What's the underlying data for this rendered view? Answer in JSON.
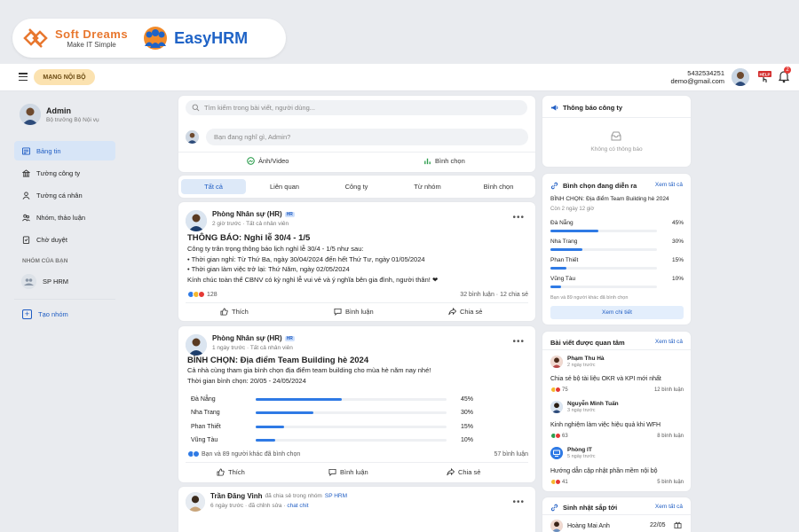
{
  "brand": {
    "softdreams_name": "Soft Dreams",
    "softdreams_tagline": "Make IT Simple",
    "product": "EasyHRM"
  },
  "topbar": {
    "internal_button": "MẠNG NỘI BỘ",
    "user_phone": "5432534251",
    "user_email": "demo@gmail.com",
    "help_label": "HELP",
    "notif_count": "2"
  },
  "sidebar": {
    "user_name": "Admin",
    "user_role": "Bộ trưởng Bộ Nội vụ",
    "items": [
      {
        "label": "Bảng tin",
        "icon": "newsfeed-icon"
      },
      {
        "label": "Tường công ty",
        "icon": "building-icon"
      },
      {
        "label": "Tường cá nhân",
        "icon": "person-icon"
      },
      {
        "label": "Nhóm, thảo luận",
        "icon": "group-icon"
      },
      {
        "label": "Chờ duyệt",
        "icon": "pending-icon"
      }
    ],
    "group_title": "NHÓM CỦA BẠN",
    "group_item": "SP HRM",
    "create_group": "Tạo nhóm"
  },
  "feed": {
    "search_placeholder": "Tìm kiếm trong bài viết, người dùng...",
    "composer_placeholder": "Bạn đang nghĩ gì, Admin?",
    "photo_label": "Ảnh/Video",
    "poll_label": "Bình chọn",
    "tabs": [
      "Tất cả",
      "Liên quan",
      "Công ty",
      "Từ nhóm",
      "Bình chọn"
    ]
  },
  "post1": {
    "author": "Phòng Nhân sự (HR)",
    "tag": "HR",
    "time": "2 giờ trước",
    "audience": "Tất cả nhân viên",
    "title": "THÔNG BÁO: Nghỉ lễ 30/4 - 1/5",
    "lines": [
      "Công ty trân trọng thông báo lịch nghỉ lễ 30/4 - 1/5 như sau:",
      "• Thời gian nghỉ: Từ Thứ Ba, ngày 30/04/2024 đến hết Thứ Tư, ngày 01/05/2024",
      "• Thời gian làm việc trở lại: Thứ Năm, ngày 02/05/2024",
      "Kính chúc toàn thể CBNV có kỳ nghỉ lễ vui vẻ và ý nghĩa bên gia đình, người thân! ❤"
    ],
    "reactions": "128",
    "comments": "32 bình luận",
    "shares": "12 chia sẻ",
    "like": "Thích",
    "comment": "Bình luận",
    "share": "Chia sẻ"
  },
  "post2": {
    "author": "Phòng Nhân sự (HR)",
    "tag": "HR",
    "time": "1 ngày trước",
    "audience": "Tất cả nhân viên",
    "title": "BÌNH CHỌN: Địa điểm Team Building hè 2024",
    "lines": [
      "Cả nhà cùng tham gia bình chọn địa điểm team building cho mùa hè năm nay nhé!",
      "Thời gian bình chọn: 20/05 - 24/05/2024"
    ],
    "options": [
      {
        "label": "Đà Nẵng",
        "pct": "45%",
        "value": 45
      },
      {
        "label": "Nha Trang",
        "pct": "30%",
        "value": 30
      },
      {
        "label": "Phan Thiết",
        "pct": "15%",
        "value": 15
      },
      {
        "label": "Vũng Tàu",
        "pct": "10%",
        "value": 10
      }
    ],
    "voters": "Bạn và 89 người khác đã bình chọn",
    "comments": "57 bình luận",
    "like": "Thích",
    "comment": "Bình luận",
    "share": "Chia sẻ"
  },
  "post3": {
    "author": "Trần Đăng Vinh",
    "shared_text": "đã chia sẻ trong nhóm",
    "group": "SP HRM",
    "time": "6 ngày trước",
    "edited": "đã chỉnh sửa",
    "tag": "chat chit"
  },
  "right": {
    "announce_title": "Thông báo công ty",
    "announce_empty": "Không có thông báo",
    "poll_title": "Bình chọn đang diễn ra",
    "poll_link": "Xem tất cả",
    "poll_question": "BÌNH CHỌN: Địa điểm Team Building hè 2024",
    "poll_remaining": "Còn 2 ngày 12 giờ",
    "poll_options": [
      {
        "label": "Đà Nẵng",
        "pct": "45%",
        "value": 45
      },
      {
        "label": "Nha Trang",
        "pct": "30%",
        "value": 30
      },
      {
        "label": "Phan Thiết",
        "pct": "15%",
        "value": 15
      },
      {
        "label": "Vũng Tàu",
        "pct": "10%",
        "value": 10
      }
    ],
    "poll_voters": "Bạn và 89 người khác đã bình chọn",
    "poll_btn": "Xem chi tiết",
    "interest_title": "Bài viết được quan tâm",
    "interest_link": "Xem tất cả",
    "interest": [
      {
        "name": "Phạm Thu Hà",
        "time": "2 ngày trước",
        "title": "Chia sẻ bộ tài liệu OKR và KPI mới nhất",
        "reacts": "75",
        "comments": "12 bình luận"
      },
      {
        "name": "Nguyễn Minh Tuấn",
        "time": "3 ngày trước",
        "title": "Kinh nghiệm làm việc hiệu quả khi WFH",
        "reacts": "63",
        "comments": "8 bình luận"
      },
      {
        "name": "Phòng IT",
        "time": "5 ngày trước",
        "title": "Hướng dẫn cập nhật phần mềm nội bộ",
        "reacts": "41",
        "comments": "5 bình luận"
      }
    ],
    "birthday_title": "Sinh nhật sắp tới",
    "birthday_link": "Xem tất cả",
    "birthday_name": "Hoàng Mai Anh",
    "birthday_date": "22/05"
  },
  "colors": {
    "accent": "#1e5cc3",
    "bar": "#2f7ae5",
    "brand_orange": "#e8772e",
    "internal_bg": "#fbe2b0"
  }
}
